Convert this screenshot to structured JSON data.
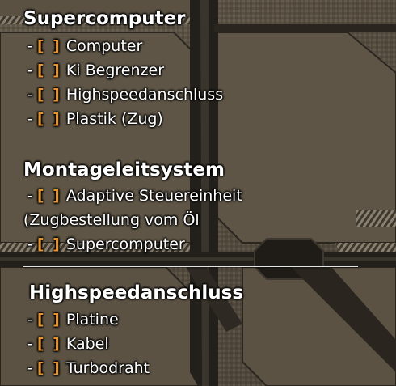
{
  "sections": [
    {
      "title": "Supercomputer",
      "items": [
        {
          "dash": "-",
          "checkbox": "[ ]",
          "label": "Computer"
        },
        {
          "dash": "-",
          "checkbox": "[ ]",
          "label": "Ki Begrenzer"
        },
        {
          "dash": "-",
          "checkbox": "[ ]",
          "label": "Highspeedanschluss"
        },
        {
          "dash": "-",
          "checkbox": "[ ]",
          "label": "Plastik (Zug)"
        }
      ]
    },
    {
      "title": "Montageleitsystem",
      "items": [
        {
          "dash": "-",
          "checkbox": "[ ]",
          "label": "Adaptive Steuereinheit",
          "continuation": "(Zugbestellung vom Öl"
        },
        {
          "dash": "-",
          "checkbox": "[ ]",
          "label": "Supercomputer"
        }
      ]
    },
    {
      "title": "Highspeedanschluss",
      "items": [
        {
          "dash": "-",
          "checkbox": "[ ]",
          "label": "Platine"
        },
        {
          "dash": "-",
          "checkbox": "[ ]",
          "label": "Kabel"
        },
        {
          "dash": "-",
          "checkbox": "[ ]",
          "label": "Turbodraht"
        }
      ]
    }
  ],
  "colors": {
    "checkbox": "#e8922a",
    "text": "#ffffff",
    "panel": "#5c5244",
    "seam": "#1e1c18"
  }
}
